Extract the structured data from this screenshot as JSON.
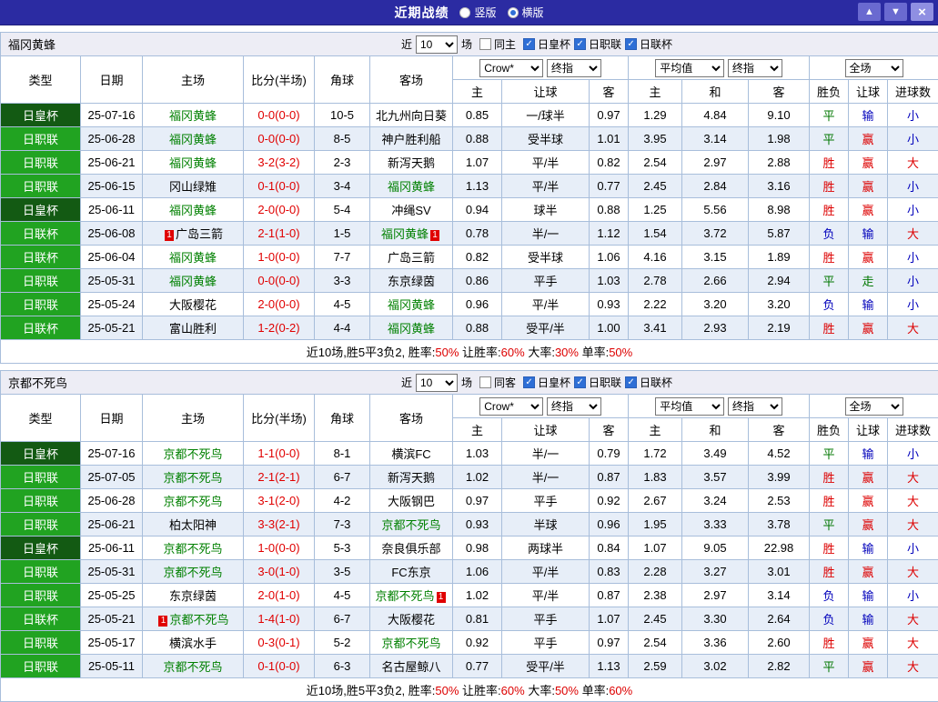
{
  "titlebar": {
    "title": "近期战绩",
    "layout_options": [
      {
        "label": "竖版",
        "selected": false
      },
      {
        "label": "横版",
        "selected": true
      }
    ],
    "buttons": {
      "up": "▲",
      "down": "▼",
      "close": "×"
    }
  },
  "controls": {
    "recent": "近",
    "count": "10",
    "games": "场",
    "cups": [
      {
        "label": "日皇杯",
        "checked": true
      },
      {
        "label": "日职联",
        "checked": true
      },
      {
        "label": "日联杯",
        "checked": true
      }
    ]
  },
  "table_header": {
    "main_cols": [
      "类型",
      "日期",
      "主场",
      "比分(半场)",
      "角球",
      "客场"
    ],
    "asian_selects": [
      {
        "value": "Crow*"
      },
      {
        "value": "终指"
      }
    ],
    "euro_selects": [
      {
        "value": "平均值"
      },
      {
        "value": "终指"
      }
    ],
    "scope_select": {
      "value": "全场"
    },
    "sub_cols": [
      "主",
      "让球",
      "客",
      "主",
      "和",
      "客",
      "胜负",
      "让球",
      "进球数"
    ]
  },
  "colors": {
    "tracked_team": "#008000",
    "score": "#e00000",
    "type_bg": {
      "日皇杯": "#135a13",
      "日职联": "#21a321",
      "日联杯": "#21a321"
    },
    "outcome": {
      "胜": "#dd0000",
      "平": "#007700",
      "负": "#0000bb",
      "赢": "#dd0000",
      "输": "#0000bb",
      "走": "#007700",
      "大": "#dd0000",
      "小": "#0000bb"
    }
  },
  "sections": [
    {
      "team": "福冈黄蜂",
      "same": {
        "label": "同主",
        "checked": false
      },
      "rows": [
        {
          "type": "日皇杯",
          "date": "25-07-16",
          "home": "福冈黄蜂",
          "home_tracked": true,
          "home_badge": "",
          "home_badge_pos": "",
          "score": "0-0(0-0)",
          "corners": "10-5",
          "away": "北九州向日葵",
          "away_tracked": false,
          "away_badge": "",
          "away_badge_pos": "",
          "ah": [
            "0.85",
            "一/球半",
            "0.97"
          ],
          "eu": [
            "1.29",
            "4.84",
            "9.10"
          ],
          "res": [
            "平",
            "输",
            "小"
          ]
        },
        {
          "type": "日职联",
          "date": "25-06-28",
          "home": "福冈黄蜂",
          "home_tracked": true,
          "home_badge": "",
          "home_badge_pos": "",
          "score": "0-0(0-0)",
          "corners": "8-5",
          "away": "神户胜利船",
          "away_tracked": false,
          "away_badge": "",
          "away_badge_pos": "",
          "ah": [
            "0.88",
            "受半球",
            "1.01"
          ],
          "eu": [
            "3.95",
            "3.14",
            "1.98"
          ],
          "res": [
            "平",
            "赢",
            "小"
          ]
        },
        {
          "type": "日职联",
          "date": "25-06-21",
          "home": "福冈黄蜂",
          "home_tracked": true,
          "home_badge": "",
          "home_badge_pos": "",
          "score": "3-2(3-2)",
          "corners": "2-3",
          "away": "新泻天鹅",
          "away_tracked": false,
          "away_badge": "",
          "away_badge_pos": "",
          "ah": [
            "1.07",
            "平/半",
            "0.82"
          ],
          "eu": [
            "2.54",
            "2.97",
            "2.88"
          ],
          "res": [
            "胜",
            "赢",
            "大"
          ]
        },
        {
          "type": "日职联",
          "date": "25-06-15",
          "home": "冈山绿雉",
          "home_tracked": false,
          "home_badge": "",
          "home_badge_pos": "",
          "score": "0-1(0-0)",
          "corners": "3-4",
          "away": "福冈黄蜂",
          "away_tracked": true,
          "away_badge": "",
          "away_badge_pos": "",
          "ah": [
            "1.13",
            "平/半",
            "0.77"
          ],
          "eu": [
            "2.45",
            "2.84",
            "3.16"
          ],
          "res": [
            "胜",
            "赢",
            "小"
          ]
        },
        {
          "type": "日皇杯",
          "date": "25-06-11",
          "home": "福冈黄蜂",
          "home_tracked": true,
          "home_badge": "",
          "home_badge_pos": "",
          "score": "2-0(0-0)",
          "corners": "5-4",
          "away": "冲绳SV",
          "away_tracked": false,
          "away_badge": "",
          "away_badge_pos": "",
          "ah": [
            "0.94",
            "球半",
            "0.88"
          ],
          "eu": [
            "1.25",
            "5.56",
            "8.98"
          ],
          "res": [
            "胜",
            "赢",
            "小"
          ]
        },
        {
          "type": "日联杯",
          "date": "25-06-08",
          "home": "广岛三箭",
          "home_tracked": false,
          "home_badge": "1",
          "home_badge_pos": "before",
          "score": "2-1(1-0)",
          "corners": "1-5",
          "away": "福冈黄蜂",
          "away_tracked": true,
          "away_badge": "1",
          "away_badge_pos": "after",
          "ah": [
            "0.78",
            "半/一",
            "1.12"
          ],
          "eu": [
            "1.54",
            "3.72",
            "5.87"
          ],
          "res": [
            "负",
            "输",
            "大"
          ]
        },
        {
          "type": "日联杯",
          "date": "25-06-04",
          "home": "福冈黄蜂",
          "home_tracked": true,
          "home_badge": "",
          "home_badge_pos": "",
          "score": "1-0(0-0)",
          "corners": "7-7",
          "away": "广岛三箭",
          "away_tracked": false,
          "away_badge": "",
          "away_badge_pos": "",
          "ah": [
            "0.82",
            "受半球",
            "1.06"
          ],
          "eu": [
            "4.16",
            "3.15",
            "1.89"
          ],
          "res": [
            "胜",
            "赢",
            "小"
          ]
        },
        {
          "type": "日职联",
          "date": "25-05-31",
          "home": "福冈黄蜂",
          "home_tracked": true,
          "home_badge": "",
          "home_badge_pos": "",
          "score": "0-0(0-0)",
          "corners": "3-3",
          "away": "东京绿茵",
          "away_tracked": false,
          "away_badge": "",
          "away_badge_pos": "",
          "ah": [
            "0.86",
            "平手",
            "1.03"
          ],
          "eu": [
            "2.78",
            "2.66",
            "2.94"
          ],
          "res": [
            "平",
            "走",
            "小"
          ]
        },
        {
          "type": "日职联",
          "date": "25-05-24",
          "home": "大阪樱花",
          "home_tracked": false,
          "home_badge": "",
          "home_badge_pos": "",
          "score": "2-0(0-0)",
          "corners": "4-5",
          "away": "福冈黄蜂",
          "away_tracked": true,
          "away_badge": "",
          "away_badge_pos": "",
          "ah": [
            "0.96",
            "平/半",
            "0.93"
          ],
          "eu": [
            "2.22",
            "3.20",
            "3.20"
          ],
          "res": [
            "负",
            "输",
            "小"
          ]
        },
        {
          "type": "日联杯",
          "date": "25-05-21",
          "home": "富山胜利",
          "home_tracked": false,
          "home_badge": "",
          "home_badge_pos": "",
          "score": "1-2(0-2)",
          "corners": "4-4",
          "away": "福冈黄蜂",
          "away_tracked": true,
          "away_badge": "",
          "away_badge_pos": "",
          "ah": [
            "0.88",
            "受平/半",
            "1.00"
          ],
          "eu": [
            "3.41",
            "2.93",
            "2.19"
          ],
          "res": [
            "胜",
            "赢",
            "大"
          ]
        }
      ],
      "summary": [
        {
          "text": "近10场,胜5平3负2, 胜率:",
          "red": false
        },
        {
          "text": "50%",
          "red": true
        },
        {
          "text": " 让胜率:",
          "red": false
        },
        {
          "text": "60%",
          "red": true
        },
        {
          "text": " 大率:",
          "red": false
        },
        {
          "text": "30%",
          "red": true
        },
        {
          "text": " 单率:",
          "red": false
        },
        {
          "text": "50%",
          "red": true
        }
      ]
    },
    {
      "team": "京都不死鸟",
      "same": {
        "label": "同客",
        "checked": false
      },
      "rows": [
        {
          "type": "日皇杯",
          "date": "25-07-16",
          "home": "京都不死鸟",
          "home_tracked": true,
          "home_badge": "",
          "home_badge_pos": "",
          "score": "1-1(0-0)",
          "corners": "8-1",
          "away": "横滨FC",
          "away_tracked": false,
          "away_badge": "",
          "away_badge_pos": "",
          "ah": [
            "1.03",
            "半/一",
            "0.79"
          ],
          "eu": [
            "1.72",
            "3.49",
            "4.52"
          ],
          "res": [
            "平",
            "输",
            "小"
          ]
        },
        {
          "type": "日职联",
          "date": "25-07-05",
          "home": "京都不死鸟",
          "home_tracked": true,
          "home_badge": "",
          "home_badge_pos": "",
          "score": "2-1(2-1)",
          "corners": "6-7",
          "away": "新泻天鹅",
          "away_tracked": false,
          "away_badge": "",
          "away_badge_pos": "",
          "ah": [
            "1.02",
            "半/一",
            "0.87"
          ],
          "eu": [
            "1.83",
            "3.57",
            "3.99"
          ],
          "res": [
            "胜",
            "赢",
            "大"
          ]
        },
        {
          "type": "日职联",
          "date": "25-06-28",
          "home": "京都不死鸟",
          "home_tracked": true,
          "home_badge": "",
          "home_badge_pos": "",
          "score": "3-1(2-0)",
          "corners": "4-2",
          "away": "大阪钢巴",
          "away_tracked": false,
          "away_badge": "",
          "away_badge_pos": "",
          "ah": [
            "0.97",
            "平手",
            "0.92"
          ],
          "eu": [
            "2.67",
            "3.24",
            "2.53"
          ],
          "res": [
            "胜",
            "赢",
            "大"
          ]
        },
        {
          "type": "日职联",
          "date": "25-06-21",
          "home": "柏太阳神",
          "home_tracked": false,
          "home_badge": "",
          "home_badge_pos": "",
          "score": "3-3(2-1)",
          "corners": "7-3",
          "away": "京都不死鸟",
          "away_tracked": true,
          "away_badge": "",
          "away_badge_pos": "",
          "ah": [
            "0.93",
            "半球",
            "0.96"
          ],
          "eu": [
            "1.95",
            "3.33",
            "3.78"
          ],
          "res": [
            "平",
            "赢",
            "大"
          ]
        },
        {
          "type": "日皇杯",
          "date": "25-06-11",
          "home": "京都不死鸟",
          "home_tracked": true,
          "home_badge": "",
          "home_badge_pos": "",
          "score": "1-0(0-0)",
          "corners": "5-3",
          "away": "奈良俱乐部",
          "away_tracked": false,
          "away_badge": "",
          "away_badge_pos": "",
          "ah": [
            "0.98",
            "两球半",
            "0.84"
          ],
          "eu": [
            "1.07",
            "9.05",
            "22.98"
          ],
          "res": [
            "胜",
            "输",
            "小"
          ]
        },
        {
          "type": "日职联",
          "date": "25-05-31",
          "home": "京都不死鸟",
          "home_tracked": true,
          "home_badge": "",
          "home_badge_pos": "",
          "score": "3-0(1-0)",
          "corners": "3-5",
          "away": "FC东京",
          "away_tracked": false,
          "away_badge": "",
          "away_badge_pos": "",
          "ah": [
            "1.06",
            "平/半",
            "0.83"
          ],
          "eu": [
            "2.28",
            "3.27",
            "3.01"
          ],
          "res": [
            "胜",
            "赢",
            "大"
          ]
        },
        {
          "type": "日职联",
          "date": "25-05-25",
          "home": "东京绿茵",
          "home_tracked": false,
          "home_badge": "",
          "home_badge_pos": "",
          "score": "2-0(1-0)",
          "corners": "4-5",
          "away": "京都不死鸟",
          "away_tracked": true,
          "away_badge": "1",
          "away_badge_pos": "after",
          "ah": [
            "1.02",
            "平/半",
            "0.87"
          ],
          "eu": [
            "2.38",
            "2.97",
            "3.14"
          ],
          "res": [
            "负",
            "输",
            "小"
          ]
        },
        {
          "type": "日联杯",
          "date": "25-05-21",
          "home": "京都不死鸟",
          "home_tracked": true,
          "home_badge": "1",
          "home_badge_pos": "before",
          "score": "1-4(1-0)",
          "corners": "6-7",
          "away": "大阪樱花",
          "away_tracked": false,
          "away_badge": "",
          "away_badge_pos": "",
          "ah": [
            "0.81",
            "平手",
            "1.07"
          ],
          "eu": [
            "2.45",
            "3.30",
            "2.64"
          ],
          "res": [
            "负",
            "输",
            "大"
          ]
        },
        {
          "type": "日职联",
          "date": "25-05-17",
          "home": "横滨水手",
          "home_tracked": false,
          "home_badge": "",
          "home_badge_pos": "",
          "score": "0-3(0-1)",
          "corners": "5-2",
          "away": "京都不死鸟",
          "away_tracked": true,
          "away_badge": "",
          "away_badge_pos": "",
          "ah": [
            "0.92",
            "平手",
            "0.97"
          ],
          "eu": [
            "2.54",
            "3.36",
            "2.60"
          ],
          "res": [
            "胜",
            "赢",
            "大"
          ]
        },
        {
          "type": "日职联",
          "date": "25-05-11",
          "home": "京都不死鸟",
          "home_tracked": true,
          "home_badge": "",
          "home_badge_pos": "",
          "score": "0-1(0-0)",
          "corners": "6-3",
          "away": "名古屋鲸八",
          "away_tracked": false,
          "away_badge": "",
          "away_badge_pos": "",
          "ah": [
            "0.77",
            "受平/半",
            "1.13"
          ],
          "eu": [
            "2.59",
            "3.02",
            "2.82"
          ],
          "res": [
            "平",
            "赢",
            "大"
          ]
        }
      ],
      "summary": [
        {
          "text": "近10场,胜5平3负2, 胜率:",
          "red": false
        },
        {
          "text": "50%",
          "red": true
        },
        {
          "text": " 让胜率:",
          "red": false
        },
        {
          "text": "60%",
          "red": true
        },
        {
          "text": " 大率:",
          "red": false
        },
        {
          "text": "50%",
          "red": true
        },
        {
          "text": " 单率:",
          "red": false
        },
        {
          "text": "60%",
          "red": true
        }
      ]
    }
  ]
}
